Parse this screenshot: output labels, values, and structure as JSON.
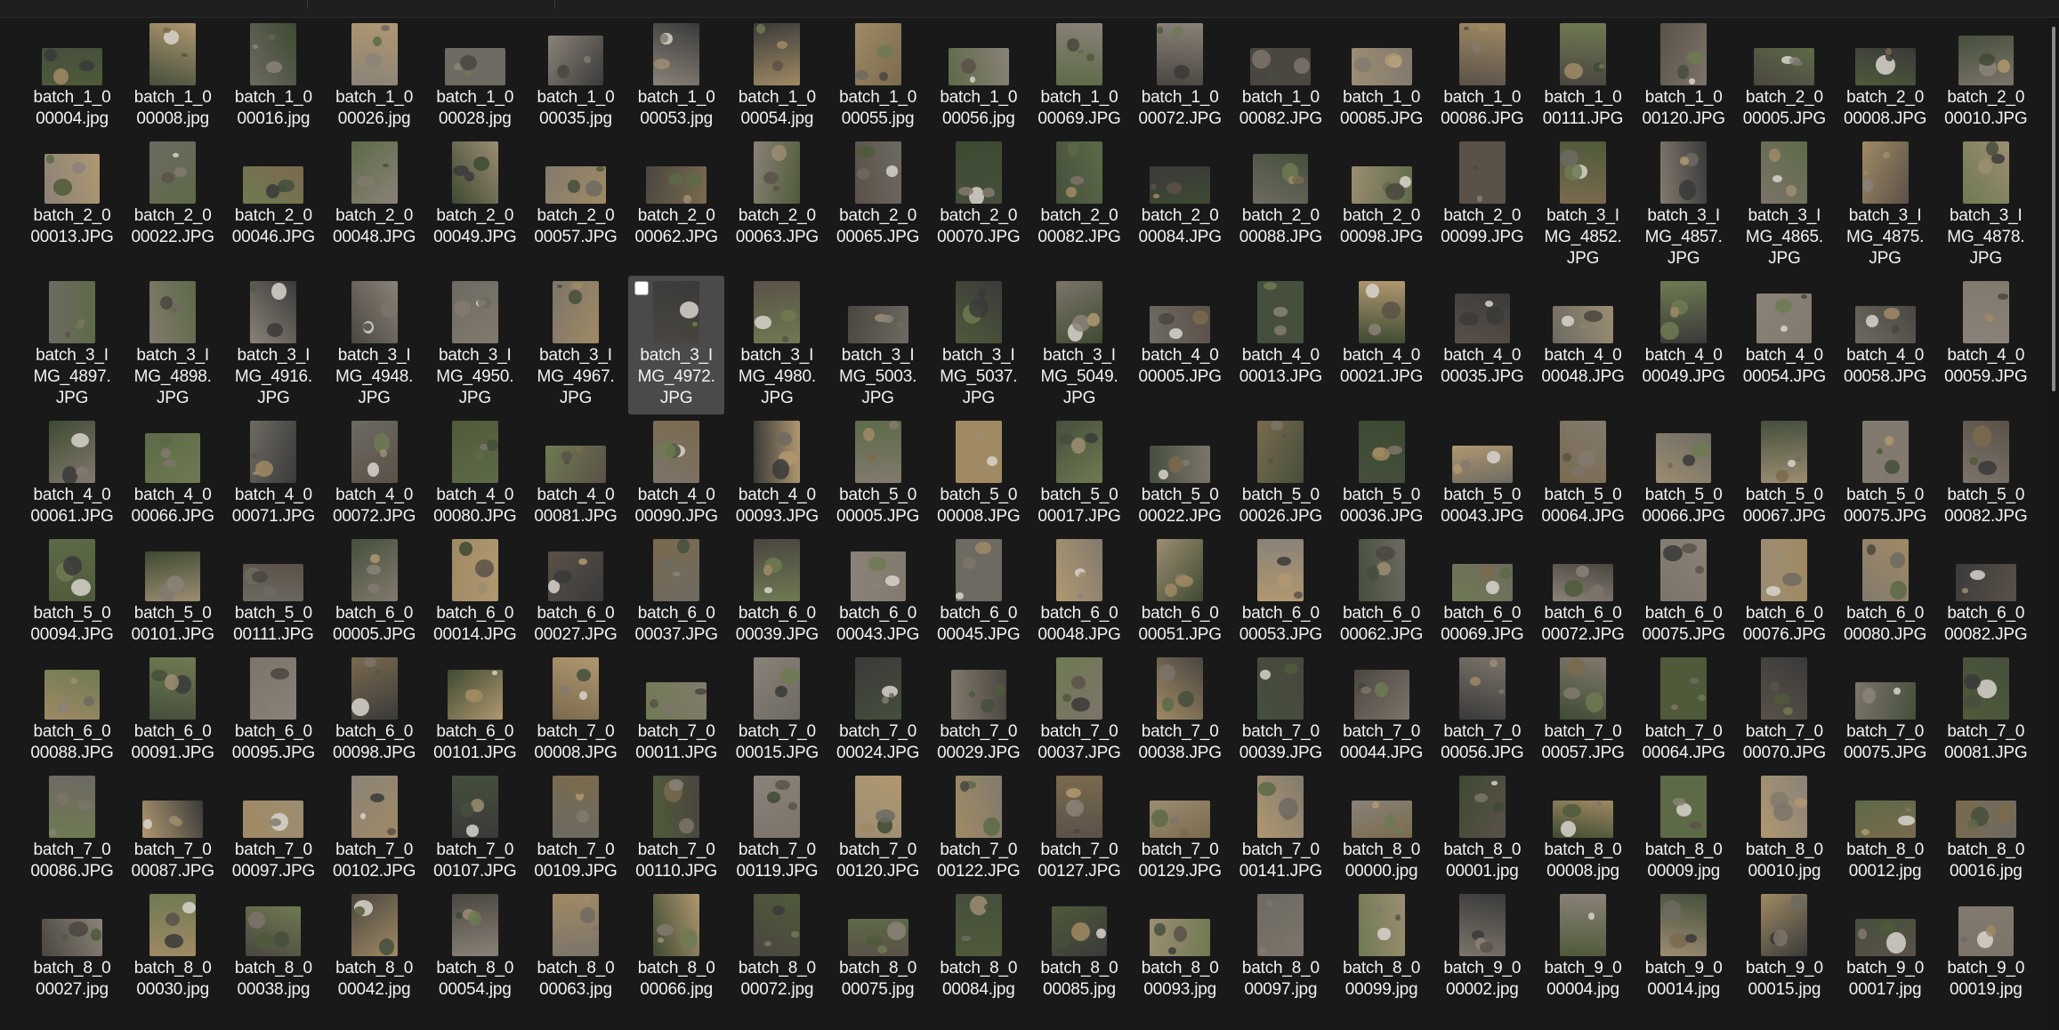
{
  "files": [
    [
      "batch_1_000004.jpg",
      "batch_1_000008.jpg",
      "batch_1_000016.jpg",
      "batch_1_000026.jpg",
      "batch_1_000028.jpg",
      "batch_1_000035.jpg",
      "batch_1_000053.jpg",
      "batch_1_000054.jpg",
      "batch_1_000055.jpg",
      "batch_1_000056.jpg",
      "batch_1_000069.JPG",
      "batch_1_000072.JPG",
      "batch_1_000082.JPG",
      "batch_1_000085.JPG",
      "batch_1_000086.JPG",
      "batch_1_000111.JPG",
      "batch_1_000120.JPG",
      "batch_2_000005.JPG",
      "batch_2_000008.JPG",
      "batch_2_000010.JPG"
    ],
    [
      "batch_2_000013.JPG",
      "batch_2_000022.JPG",
      "batch_2_000046.JPG",
      "batch_2_000048.JPG",
      "batch_2_000049.JPG",
      "batch_2_000057.JPG",
      "batch_2_000062.JPG",
      "batch_2_000063.JPG",
      "batch_2_000065.JPG",
      "batch_2_000070.JPG",
      "batch_2_000082.JPG",
      "batch_2_000084.JPG",
      "batch_2_000088.JPG",
      "batch_2_000098.JPG",
      "batch_2_000099.JPG",
      "batch_3_IMG_4852.JPG",
      "batch_3_IMG_4857.JPG",
      "batch_3_IMG_4865.JPG",
      "batch_3_IMG_4875.JPG",
      "batch_3_IMG_4878.JPG"
    ],
    [
      "batch_3_IMG_4897.JPG",
      "batch_3_IMG_4898.JPG",
      "batch_3_IMG_4916.JPG",
      "batch_3_IMG_4948.JPG",
      "batch_3_IMG_4950.JPG",
      "batch_3_IMG_4967.JPG",
      "batch_3_IMG_4972.JPG",
      "batch_3_IMG_4980.JPG",
      "batch_3_IMG_5003.JPG",
      "batch_3_IMG_5037.JPG",
      "batch_3_IMG_5049.JPG",
      "batch_4_000005.JPG",
      "batch_4_000013.JPG",
      "batch_4_000021.JPG",
      "batch_4_000035.JPG",
      "batch_4_000048.JPG",
      "batch_4_000049.JPG",
      "batch_4_000054.JPG",
      "batch_4_000058.JPG",
      "batch_4_000059.JPG"
    ],
    [
      "batch_4_000061.JPG",
      "batch_4_000066.JPG",
      "batch_4_000071.JPG",
      "batch_4_000072.JPG",
      "batch_4_000080.JPG",
      "batch_4_000081.JPG",
      "batch_4_000090.JPG",
      "batch_4_000093.JPG",
      "batch_5_000005.JPG",
      "batch_5_000008.JPG",
      "batch_5_000017.JPG",
      "batch_5_000022.JPG",
      "batch_5_000026.JPG",
      "batch_5_000036.JPG",
      "batch_5_000043.JPG",
      "batch_5_000064.JPG",
      "batch_5_000066.JPG",
      "batch_5_000067.JPG",
      "batch_5_000075.JPG",
      "batch_5_000082.JPG"
    ],
    [
      "batch_5_000094.JPG",
      "batch_5_000101.JPG",
      "batch_5_000111.JPG",
      "batch_6_000005.JPG",
      "batch_6_000014.JPG",
      "batch_6_000027.JPG",
      "batch_6_000037.JPG",
      "batch_6_000039.JPG",
      "batch_6_000043.JPG",
      "batch_6_000045.JPG",
      "batch_6_000048.JPG",
      "batch_6_000051.JPG",
      "batch_6_000053.JPG",
      "batch_6_000062.JPG",
      "batch_6_000069.JPG",
      "batch_6_000072.JPG",
      "batch_6_000075.JPG",
      "batch_6_000076.JPG",
      "batch_6_000080.JPG",
      "batch_6_000082.JPG"
    ],
    [
      "batch_6_000088.JPG",
      "batch_6_000091.JPG",
      "batch_6_000095.JPG",
      "batch_6_000098.JPG",
      "batch_6_000101.JPG",
      "batch_7_000008.JPG",
      "batch_7_000011.JPG",
      "batch_7_000015.JPG",
      "batch_7_000024.JPG",
      "batch_7_000029.JPG",
      "batch_7_000037.JPG",
      "batch_7_000038.JPG",
      "batch_7_000039.JPG",
      "batch_7_000044.JPG",
      "batch_7_000056.JPG",
      "batch_7_000057.JPG",
      "batch_7_000064.JPG",
      "batch_7_000070.JPG",
      "batch_7_000075.JPG",
      "batch_7_000081.JPG"
    ],
    [
      "batch_7_000086.JPG",
      "batch_7_000087.JPG",
      "batch_7_000097.JPG",
      "batch_7_000102.JPG",
      "batch_7_000107.JPG",
      "batch_7_000109.JPG",
      "batch_7_000110.JPG",
      "batch_7_000119.JPG",
      "batch_7_000120.JPG",
      "batch_7_000122.JPG",
      "batch_7_000127.JPG",
      "batch_7_000129.JPG",
      "batch_7_000141.JPG",
      "batch_8_000000.jpg",
      "batch_8_000001.jpg",
      "batch_8_000008.jpg",
      "batch_8_000009.jpg",
      "batch_8_000010.jpg",
      "batch_8_000012.jpg",
      "batch_8_000016.jpg"
    ],
    [
      "batch_8_000027.jpg",
      "batch_8_000030.jpg",
      "batch_8_000038.jpg",
      "batch_8_000042.jpg",
      "batch_8_000054.jpg",
      "batch_8_000063.jpg",
      "batch_8_000066.jpg",
      "batch_8_000072.jpg",
      "batch_8_000075.jpg",
      "batch_8_000084.jpg",
      "batch_8_000085.jpg",
      "batch_8_000093.jpg",
      "batch_8_000097.jpg",
      "batch_8_000099.jpg",
      "batch_9_000002.jpg",
      "batch_9_000004.jpg",
      "batch_9_000014.jpg",
      "batch_9_000015.jpg",
      "batch_9_000017.jpg",
      "batch_9_000019.jpg"
    ]
  ],
  "selected": {
    "row": 2,
    "col": 6
  },
  "palette": [
    "#6d6a62",
    "#4f5a3a",
    "#7a6a4e",
    "#8a8278",
    "#3e4a32",
    "#5a5148",
    "#9c8d72",
    "#3a3a3a",
    "#6f7a52",
    "#a08a64",
    "#4a4640",
    "#827a6e",
    "#5d6a48",
    "#b09870",
    "#454f3c",
    "#7c746a"
  ]
}
